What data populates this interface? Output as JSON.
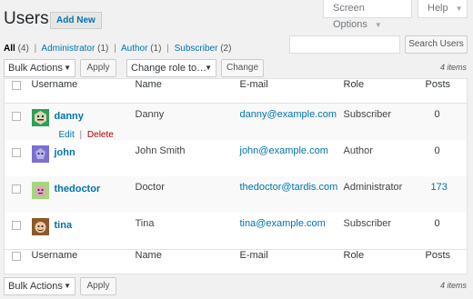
{
  "page": {
    "title": "Users",
    "add_new": "Add New",
    "screen_options": "Screen Options",
    "help": "Help"
  },
  "filters": [
    {
      "label": "All",
      "count": "(4)",
      "current": true
    },
    {
      "label": "Administrator",
      "count": "(1)"
    },
    {
      "label": "Author",
      "count": "(1)"
    },
    {
      "label": "Subscriber",
      "count": "(2)"
    }
  ],
  "search": {
    "placeholder": "",
    "button": "Search Users"
  },
  "top_nav": {
    "bulk_actions": "Bulk Actions",
    "apply": "Apply",
    "change_role": "Change role to…",
    "change": "Change",
    "items": "4 items"
  },
  "bottom_nav": {
    "bulk_actions": "Bulk Actions",
    "apply": "Apply",
    "items": "4 items"
  },
  "columns": {
    "username": "Username",
    "name": "Name",
    "email": "E-mail",
    "role": "Role",
    "posts": "Posts"
  },
  "row_actions": {
    "edit": "Edit",
    "delete": "Delete"
  },
  "users": [
    {
      "username": "danny",
      "name": "Danny",
      "email": "danny@example.com",
      "role": "Subscriber",
      "posts": "0",
      "avatar_color": "#2e9e5b",
      "avatar_face": "#dcd9b0"
    },
    {
      "username": "john",
      "name": "John Smith",
      "email": "john@example.com",
      "role": "Author",
      "posts": "0",
      "avatar_color": "#7b6fd1",
      "avatar_face": "#b9b3ea"
    },
    {
      "username": "thedoctor",
      "name": "Doctor",
      "email": "thedoctor@tardis.com",
      "role": "Administrator",
      "posts": "173",
      "avatar_color": "#a3d977",
      "avatar_face": "#e8a0c8"
    },
    {
      "username": "tina",
      "name": "Tina",
      "email": "tina@example.com",
      "role": "Subscriber",
      "posts": "0",
      "avatar_color": "#8a5a2b",
      "avatar_face": "#f2c9a0"
    }
  ]
}
